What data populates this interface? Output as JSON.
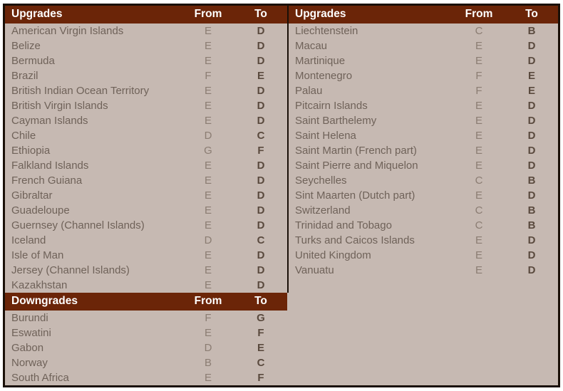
{
  "tables": {
    "upgrades_left": {
      "headers": {
        "name": "Upgrades",
        "from": "From",
        "to": "To"
      },
      "rows": [
        {
          "name": "American Virgin Islands",
          "from": "E",
          "to": "D"
        },
        {
          "name": "Belize",
          "from": "E",
          "to": "D"
        },
        {
          "name": "Bermuda",
          "from": "E",
          "to": "D"
        },
        {
          "name": "Brazil",
          "from": "F",
          "to": "E"
        },
        {
          "name": "British Indian Ocean Territory",
          "from": "E",
          "to": "D"
        },
        {
          "name": "British Virgin Islands",
          "from": "E",
          "to": "D"
        },
        {
          "name": "Cayman Islands",
          "from": "E",
          "to": "D"
        },
        {
          "name": "Chile",
          "from": "D",
          "to": "C"
        },
        {
          "name": "Ethiopia",
          "from": "G",
          "to": "F"
        },
        {
          "name": "Falkland Islands",
          "from": "E",
          "to": "D"
        },
        {
          "name": "French Guiana",
          "from": "E",
          "to": "D"
        },
        {
          "name": "Gibraltar",
          "from": "E",
          "to": "D"
        },
        {
          "name": "Guadeloupe",
          "from": "E",
          "to": "D"
        },
        {
          "name": "Guernsey (Channel Islands)",
          "from": "E",
          "to": "D"
        },
        {
          "name": "Iceland",
          "from": "D",
          "to": "C"
        },
        {
          "name": "Isle of Man",
          "from": "E",
          "to": "D"
        },
        {
          "name": "Jersey (Channel Islands)",
          "from": "E",
          "to": "D"
        },
        {
          "name": "Kazakhstan",
          "from": "E",
          "to": "D"
        }
      ]
    },
    "upgrades_right": {
      "headers": {
        "name": "Upgrades",
        "from": "From",
        "to": "To"
      },
      "rows": [
        {
          "name": "Liechtenstein",
          "from": "C",
          "to": "B"
        },
        {
          "name": "Macau",
          "from": "E",
          "to": "D"
        },
        {
          "name": "Martinique",
          "from": "E",
          "to": "D"
        },
        {
          "name": "Montenegro",
          "from": "F",
          "to": "E"
        },
        {
          "name": "Palau",
          "from": "F",
          "to": "E"
        },
        {
          "name": "Pitcairn Islands",
          "from": "E",
          "to": "D"
        },
        {
          "name": "Saint Barthelemy",
          "from": "E",
          "to": "D"
        },
        {
          "name": "Saint Helena",
          "from": "E",
          "to": "D"
        },
        {
          "name": "Saint Martin (French part)",
          "from": "E",
          "to": "D"
        },
        {
          "name": "Saint Pierre and Miquelon",
          "from": "E",
          "to": "D"
        },
        {
          "name": "Seychelles",
          "from": "C",
          "to": "B"
        },
        {
          "name": "Sint Maarten (Dutch part)",
          "from": "E",
          "to": "D"
        },
        {
          "name": "Switzerland",
          "from": "C",
          "to": "B"
        },
        {
          "name": "Trinidad and Tobago",
          "from": "C",
          "to": "B"
        },
        {
          "name": "Turks and Caicos Islands",
          "from": "E",
          "to": "D"
        },
        {
          "name": "United Kingdom",
          "from": "E",
          "to": "D"
        },
        {
          "name": "Vanuatu",
          "from": "E",
          "to": "D"
        }
      ]
    },
    "downgrades": {
      "headers": {
        "name": "Downgrades",
        "from": "From",
        "to": "To"
      },
      "rows": [
        {
          "name": "Burundi",
          "from": "F",
          "to": "G"
        },
        {
          "name": "Eswatini",
          "from": "E",
          "to": "F"
        },
        {
          "name": "Gabon",
          "from": "D",
          "to": "E"
        },
        {
          "name": "Norway",
          "from": "B",
          "to": "C"
        },
        {
          "name": "South Africa",
          "from": "E",
          "to": "F"
        }
      ]
    }
  },
  "colors": {
    "header_bar": "#6b2508",
    "body_background": "#c6b9b2",
    "frame": "#1a1008",
    "name_text": "#6f6259",
    "from_text": "#8b7d73",
    "to_text": "#5a4a3e",
    "header_text": "#ffffff"
  }
}
